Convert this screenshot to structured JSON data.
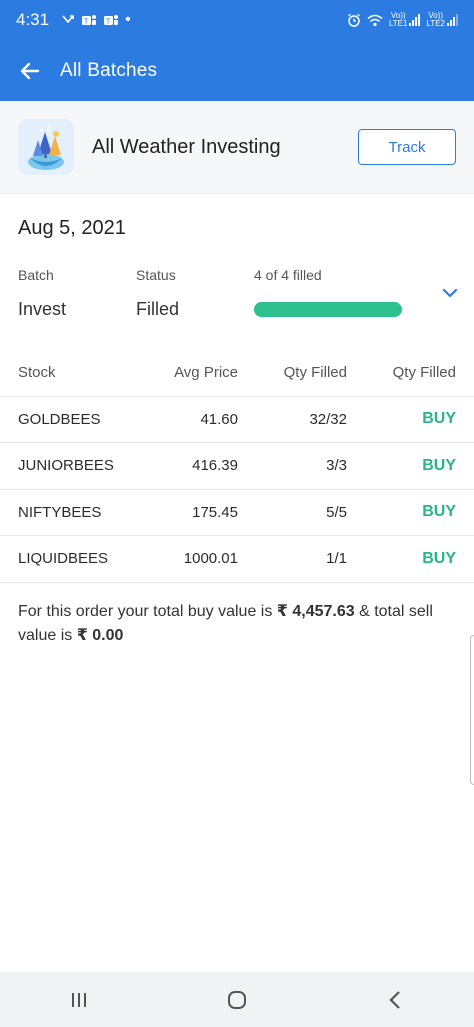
{
  "status_bar": {
    "time": "4:31",
    "left_icons": [
      "missed-call-icon",
      "teams-icon",
      "teams-icon",
      "dot-icon"
    ],
    "right_icons": [
      "alarm-icon",
      "wifi-icon",
      "lte1-signal-icon",
      "lte2-signal-icon"
    ],
    "lte1_label": "Vo))\nLTE1",
    "lte2_label": "Vo))\nLTE2"
  },
  "appbar": {
    "back_icon": "arrow-left-icon",
    "title": "All Batches"
  },
  "header": {
    "logo_icon": "weather-trees-logo-icon",
    "name": "All Weather Investing",
    "track_label": "Track"
  },
  "batch": {
    "date": "Aug 5, 2021",
    "batch_label": "Batch",
    "batch_value": "Invest",
    "status_label": "Status",
    "status_value": "Filled",
    "filled_text": "4 of 4 filled",
    "progress_fraction": 1.0,
    "expand_icon": "chevron-down-icon"
  },
  "table": {
    "headers": [
      "Stock",
      "Avg Price",
      "Qty Filled",
      "Qty Filled"
    ],
    "rows": [
      {
        "stock": "GOLDBEES",
        "avg_price": "41.60",
        "qty": "32/32",
        "action": "BUY"
      },
      {
        "stock": "JUNIORBEES",
        "avg_price": "416.39",
        "qty": "3/3",
        "action": "BUY"
      },
      {
        "stock": "NIFTYBEES",
        "avg_price": "175.45",
        "qty": "5/5",
        "action": "BUY"
      },
      {
        "stock": "LIQUIDBEES",
        "avg_price": "1000.01",
        "qty": "1/1",
        "action": "BUY"
      }
    ]
  },
  "summary": {
    "prefix": "For this order your total buy value is ",
    "buy_value": "₹ 4,457.63",
    "middle": " & total sell value is ",
    "sell_value": "₹ 0.00"
  },
  "navbar": {
    "items": [
      "recent-apps-icon",
      "home-icon",
      "back-icon"
    ]
  },
  "colors": {
    "primary": "#2b7be0",
    "buy": "#2ab48a",
    "progress": "#2ec08f"
  }
}
